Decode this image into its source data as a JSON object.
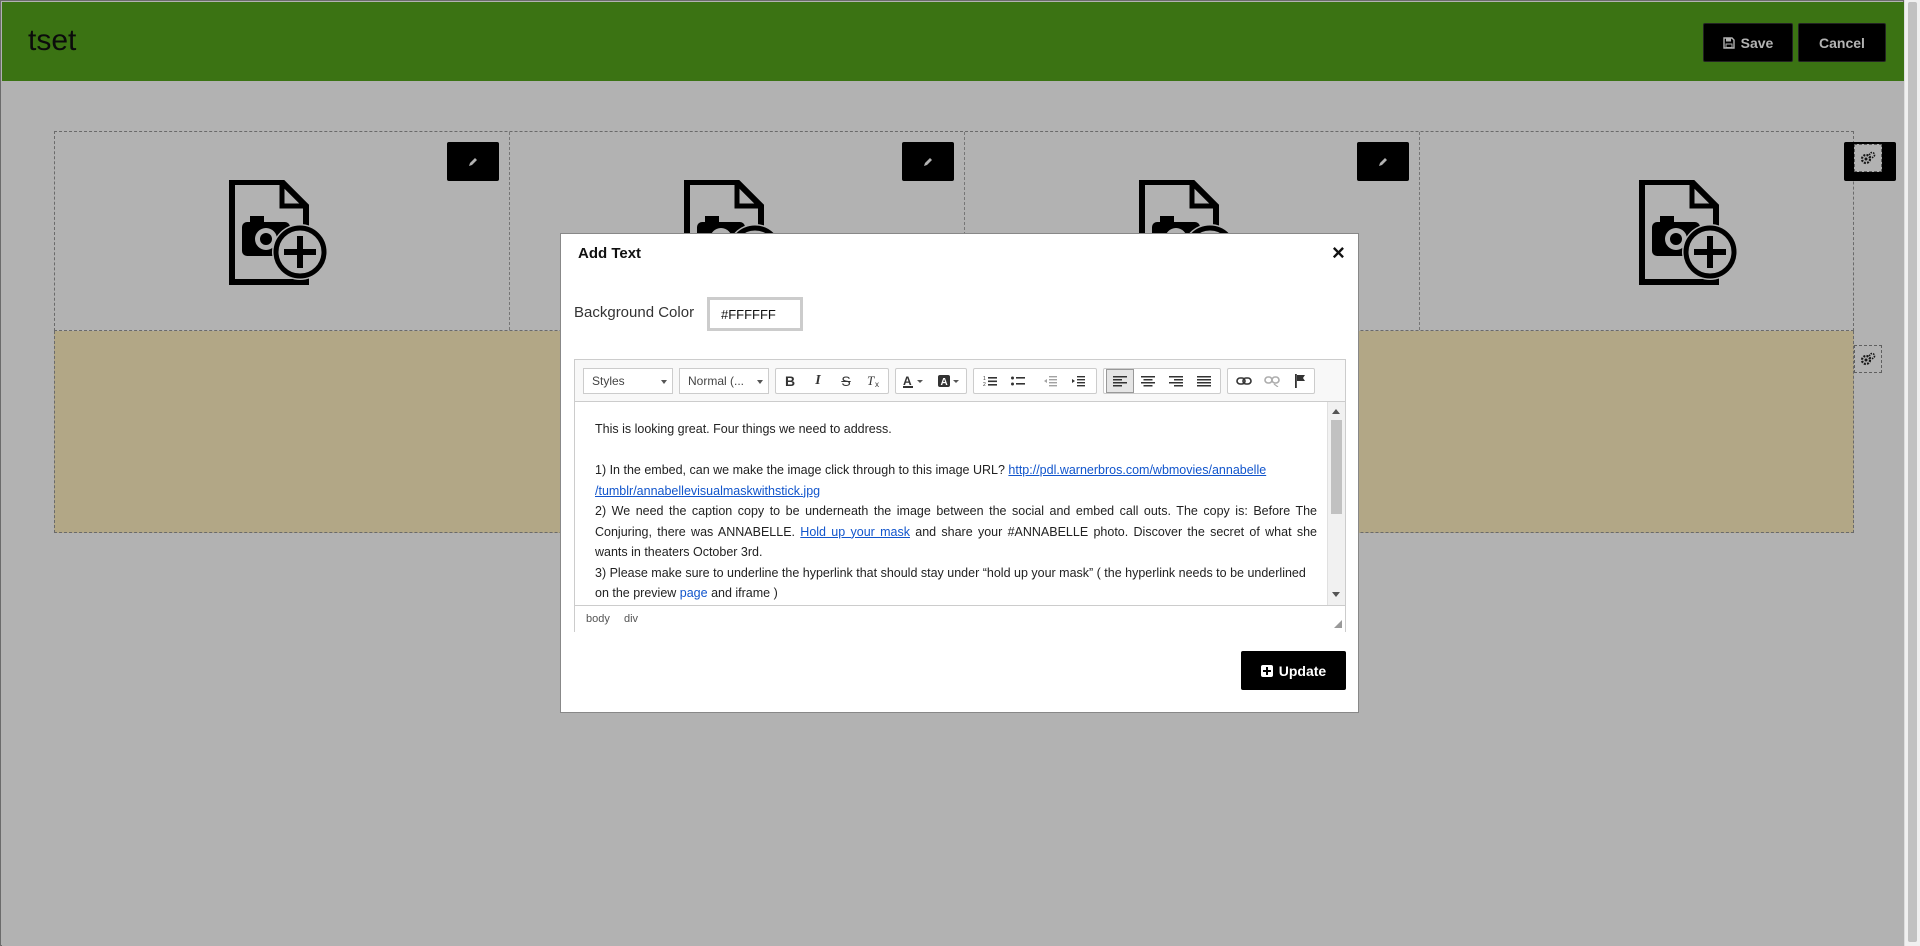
{
  "header": {
    "title": "tset",
    "save_label": "Save",
    "cancel_label": "Cancel",
    "save_icon": "floppy-disk-icon"
  },
  "colors": {
    "header_bg": "#55A51C",
    "row_bg": "#FFF0C0",
    "button_bg": "#000000"
  },
  "grid": {
    "cells": [
      {
        "edit_icon": "pencil-icon",
        "image_icon": "add-image-icon"
      },
      {
        "edit_icon": "pencil-icon",
        "image_icon": "add-image-icon"
      },
      {
        "edit_icon": "pencil-icon",
        "image_icon": "add-image-icon"
      },
      {
        "edit_icon": "pencil-icon",
        "image_icon": "add-image-icon"
      }
    ],
    "row_settings_icon": "gears-icon"
  },
  "modal": {
    "title": "Add Text",
    "close_label": "×",
    "bg_color_label": "Background Color",
    "bg_color_value": "#FFFFFF",
    "toolbar": {
      "styles_label": "Styles",
      "format_label": "Normal (...",
      "buttons": [
        "bold",
        "italic",
        "strikethrough",
        "remove-format",
        "text-color",
        "background-color",
        "numbered-list",
        "bulleted-list",
        "decrease-indent",
        "increase-indent",
        "align-left",
        "align-center",
        "align-right",
        "justify",
        "link",
        "unlink",
        "anchor"
      ],
      "bold": "B",
      "italic": "I",
      "strike": "S"
    },
    "content": {
      "line1": "This is looking great. Four things we need to address.",
      "p1_text": "1) In the embed, can we make the image click through to this image URL? ",
      "p1_link": "http://pdl.warnerbros.com/wbmovies/annabelle/tumblr/annabellevisualmaskwithstick.jpg",
      "p1_link_a": "http://pdl.warnerbros.com/wbmovies/annabelle",
      "p1_link_b": "/tumblr/annabellevisualmaskwithstick.jpg",
      "p2_text_a": "2) We need the caption copy to be underneath the image between the social and embed call outs. The copy is: Before The Conjuring, there was ANNABELLE. ",
      "p2_link": "Hold up your mask",
      "p2_text_b": " and share your #ANNABELLE photo.  Discover the secret of what she wants in theaters October 3rd.",
      "p3_text_a": "3) Please make sure to underline the hyperlink that should stay under “hold up your mask” ( the hyperlink needs to be underlined on the preview ",
      "p3_link": "page",
      "p3_text_b": " and iframe )"
    },
    "path": [
      "body",
      "div"
    ],
    "update_label": "Update",
    "update_icon": "plus-square-icon"
  }
}
